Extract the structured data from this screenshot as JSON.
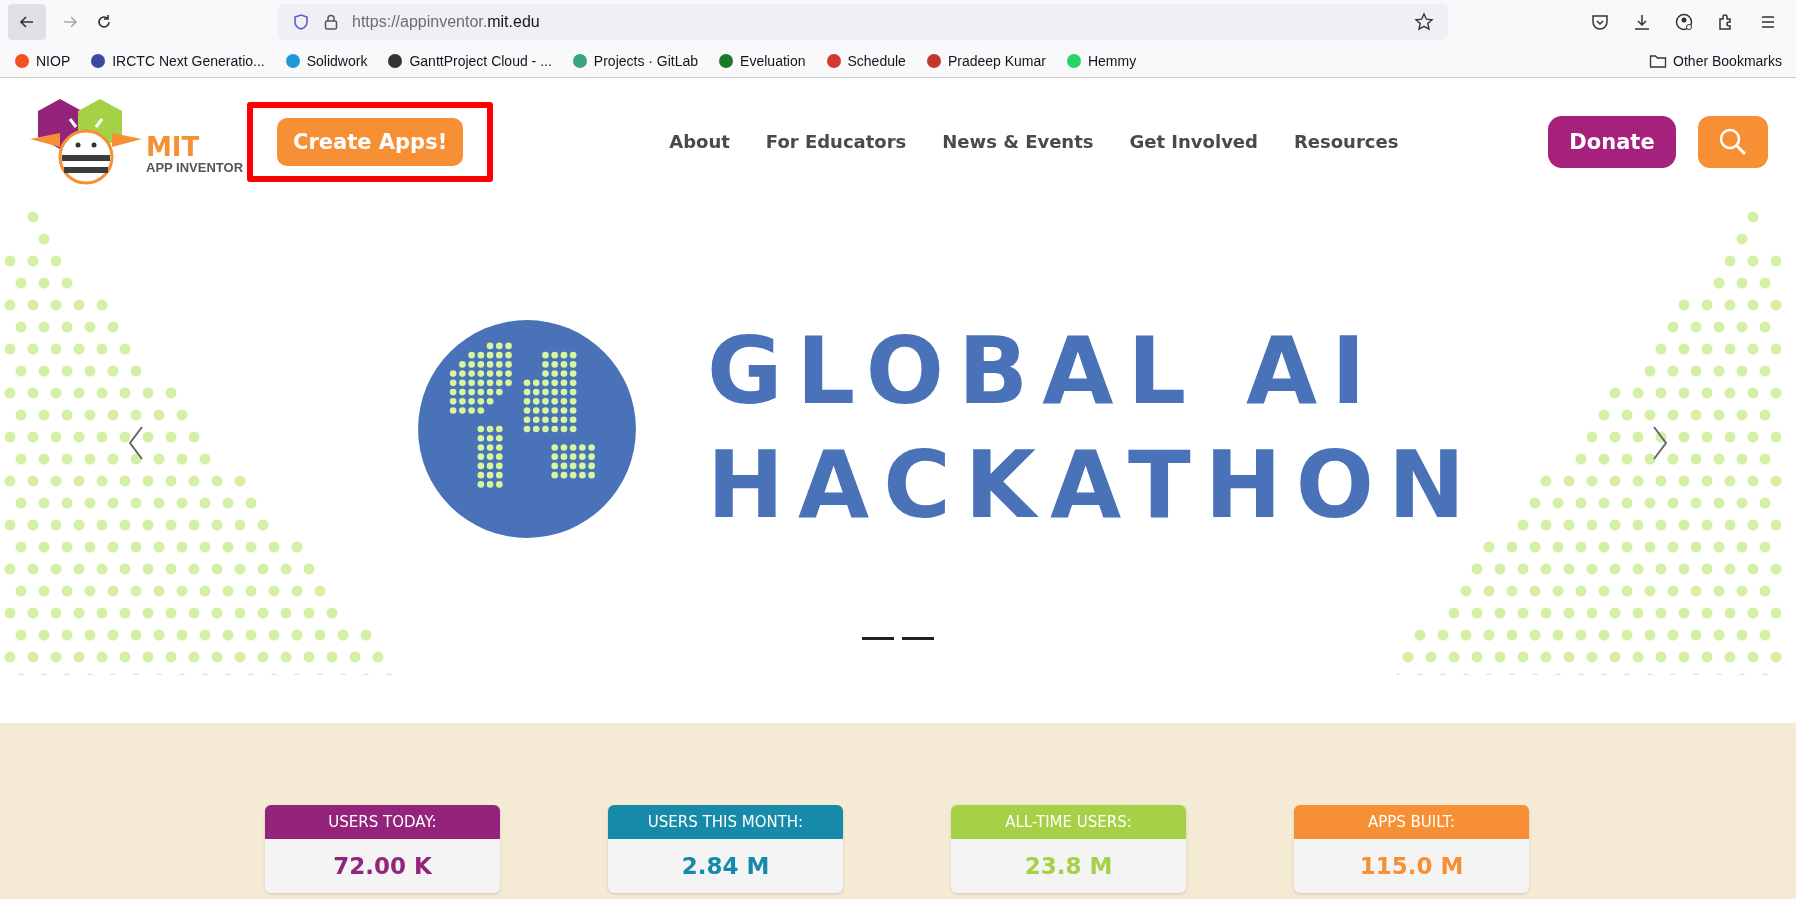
{
  "browser": {
    "url_prefix": "https://appinventor.",
    "url_domain": "mit.edu",
    "bookmarks": [
      {
        "label": "NIOP",
        "color": "#f25022"
      },
      {
        "label": "IRCTC Next Generatio...",
        "color": "#3b4aa0"
      },
      {
        "label": "Solidwork",
        "color": "#1e9ad6"
      },
      {
        "label": "GanttProject Cloud - ...",
        "color": "#333333"
      },
      {
        "label": "Projects · GitLab",
        "color": "#3aa57a"
      },
      {
        "label": "Eveluation",
        "color": "#1b7a2a"
      },
      {
        "label": "Schedule",
        "color": "#d33a2f"
      },
      {
        "label": "Pradeep Kumar",
        "color": "#c0392b"
      },
      {
        "label": "Hemmy",
        "color": "#25d366"
      }
    ],
    "other_bookmarks": "Other Bookmarks"
  },
  "header": {
    "logo": {
      "title": "MIT",
      "subtitle": "APP INVENTOR"
    },
    "create_button": "Create Apps!",
    "nav": [
      "About",
      "For Educators",
      "News & Events",
      "Get Involved",
      "Resources"
    ],
    "donate_button": "Donate"
  },
  "hero": {
    "title_lines": [
      "GLOBAL AI",
      "HACKATHON"
    ]
  },
  "stats": [
    {
      "label": "USERS TODAY:",
      "value": "72.00 K",
      "color": "#93237b"
    },
    {
      "label": "USERS THIS MONTH:",
      "value": "2.84 M",
      "color": "#168aa8"
    },
    {
      "label": "ALL-TIME USERS:",
      "value": "23.8 M",
      "color": "#a6d147"
    },
    {
      "label": "APPS BUILT:",
      "value": "115.0 M",
      "color": "#f78f34"
    }
  ]
}
